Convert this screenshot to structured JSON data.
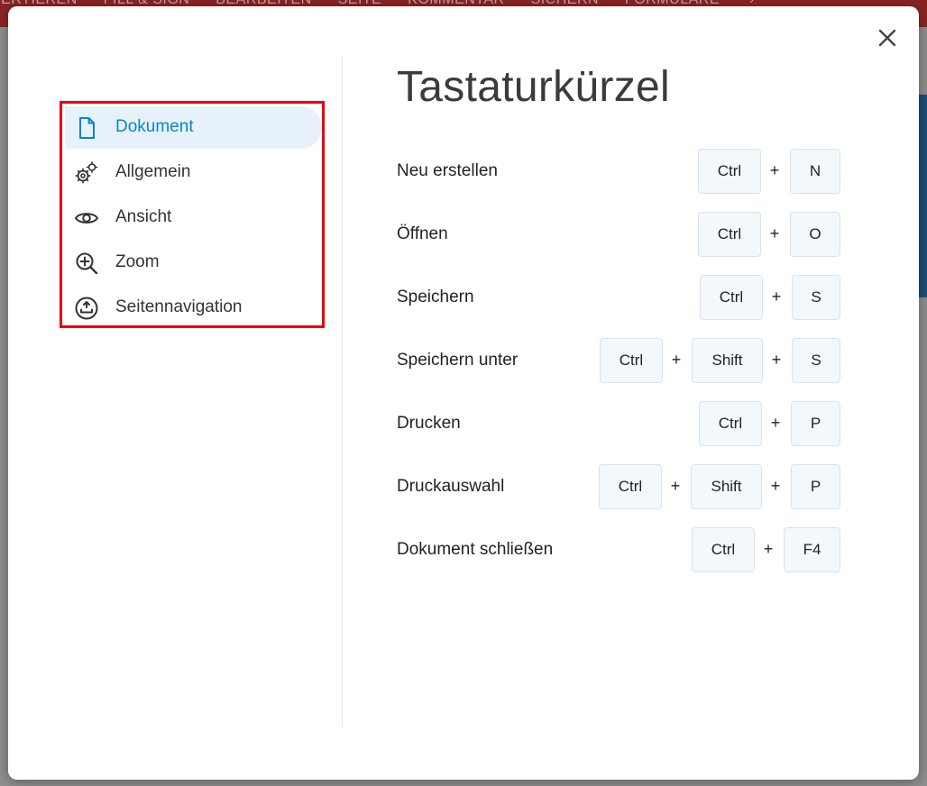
{
  "background": {
    "toolbar_tabs": [
      "VERTIEREN",
      "FILL & SIGN",
      "BEARBEITEN",
      "SEITE",
      "KOMMENTAR",
      "SICHERN",
      "FORMULARE"
    ],
    "toolbar_more": "›"
  },
  "dialog": {
    "title": "Tastaturkürzel",
    "close_label": "×"
  },
  "nav": {
    "items": [
      {
        "label": "Dokument",
        "icon": "document-icon",
        "active": true
      },
      {
        "label": "Allgemein",
        "icon": "gears-icon",
        "active": false
      },
      {
        "label": "Ansicht",
        "icon": "eye-icon",
        "active": false
      },
      {
        "label": "Zoom",
        "icon": "zoom-in-icon",
        "active": false
      },
      {
        "label": "Seitennavigation",
        "icon": "page-navigation-icon",
        "active": false
      }
    ]
  },
  "shortcuts": [
    {
      "label": "Neu erstellen",
      "keys": [
        "Ctrl",
        "N"
      ]
    },
    {
      "label": "Öffnen",
      "keys": [
        "Ctrl",
        "O"
      ]
    },
    {
      "label": "Speichern",
      "keys": [
        "Ctrl",
        "S"
      ]
    },
    {
      "label": "Speichern unter",
      "keys": [
        "Ctrl",
        "Shift",
        "S"
      ]
    },
    {
      "label": "Drucken",
      "keys": [
        "Ctrl",
        "P"
      ]
    },
    {
      "label": "Druckauswahl",
      "keys": [
        "Ctrl",
        "Shift",
        "P"
      ]
    },
    {
      "label": "Dokument schließen",
      "keys": [
        "Ctrl",
        "F4"
      ]
    }
  ],
  "key_separator": "+",
  "colors": {
    "accent": "#0b86c4",
    "active_bg": "#e6f1fb",
    "highlight_border": "#e8000f",
    "key_bg": "#f3f8fc"
  }
}
